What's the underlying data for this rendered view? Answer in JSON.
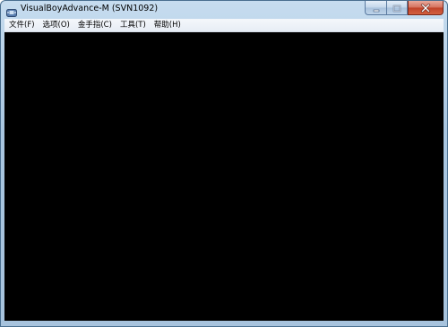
{
  "window": {
    "title": "VisualBoyAdvance-M (SVN1092)",
    "icon": "gba-app-icon"
  },
  "caption_buttons": {
    "minimize_icon": "minimize-icon",
    "maximize_icon": "maximize-icon",
    "close_icon": "close-icon",
    "close_color": "#c7442b"
  },
  "menu": {
    "items": [
      {
        "label": "文件(F)"
      },
      {
        "label": "选项(O)"
      },
      {
        "label": "金手指(C)"
      },
      {
        "label": "工具(T)"
      },
      {
        "label": "帮助(H)"
      }
    ]
  },
  "colors": {
    "frame": "#a9c6e0",
    "client_area": "#000000",
    "menubar": "#eef2f8"
  }
}
